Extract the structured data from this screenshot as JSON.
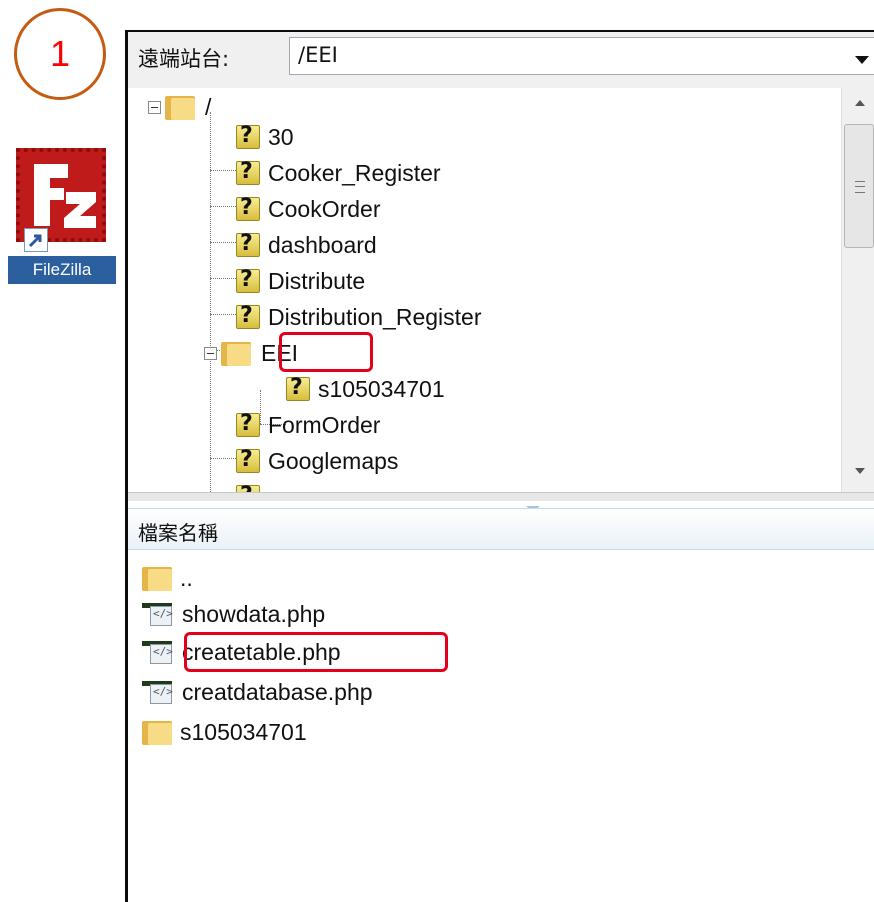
{
  "step_marker": "1",
  "desktop_icon": {
    "label": "FileZilla",
    "icon": "filezilla-logo-icon"
  },
  "site_bar": {
    "label": "遠端站台:",
    "path_value": "/EEI"
  },
  "tree": {
    "root": "/",
    "items": [
      {
        "name": "30",
        "icon": "unknown-folder-icon"
      },
      {
        "name": "Cooker_Register",
        "icon": "unknown-folder-icon"
      },
      {
        "name": "CookOrder",
        "icon": "unknown-folder-icon"
      },
      {
        "name": "dashboard",
        "icon": "unknown-folder-icon"
      },
      {
        "name": "Distribute",
        "icon": "unknown-folder-icon"
      },
      {
        "name": "Distribution_Register",
        "icon": "unknown-folder-icon"
      },
      {
        "name": "EEI",
        "icon": "folder-icon",
        "expanded": true,
        "highlighted": true
      },
      {
        "name": "s105034701",
        "icon": "unknown-folder-icon",
        "child_of": "EEI"
      },
      {
        "name": "FormOrder",
        "icon": "unknown-folder-icon"
      },
      {
        "name": "Googlemaps",
        "icon": "unknown-folder-icon"
      }
    ]
  },
  "file_list": {
    "header": "檔案名稱",
    "files": [
      {
        "name": "..",
        "type": "folder"
      },
      {
        "name": "showdata.php",
        "type": "php"
      },
      {
        "name": "createtable.php",
        "type": "php",
        "highlighted": true
      },
      {
        "name": "creatdatabase.php",
        "type": "php"
      },
      {
        "name": "s105034701",
        "type": "folder"
      }
    ]
  },
  "colors": {
    "highlight_border": "#e3001b",
    "step_circle": "#c55a11",
    "step_number": "#ff0000",
    "filezilla_red": "#bf1b1b"
  }
}
